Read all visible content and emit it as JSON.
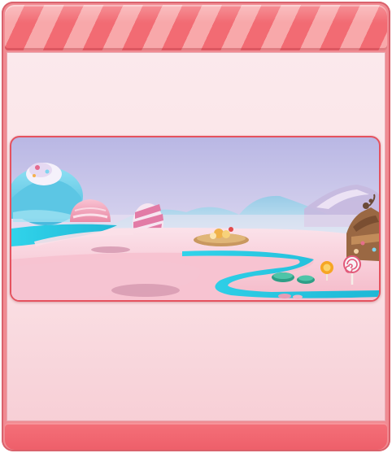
{
  "window": {
    "title": ""
  },
  "colors": {
    "frame": "#f08b92",
    "header_stripe_light": "#f8a8aa",
    "header_stripe_dark": "#f26b73",
    "body_background": "#fbe6ea",
    "footer": "#ee5f6a",
    "scene_border": "#e5525f",
    "sky": "#c9c6ea",
    "river": "#2ec8e0",
    "candy_ground": "#f7c6d4"
  },
  "scene": {
    "name": "candy-land-preview",
    "elements": [
      "cupcake-hill-icon",
      "pink-gumdrop-icon",
      "striped-candy-icon",
      "dessert-island-icon",
      "candy-house-icon",
      "orange-lollipop-icon",
      "swirl-lollipop-icon",
      "green-gumdrops-icon"
    ]
  }
}
